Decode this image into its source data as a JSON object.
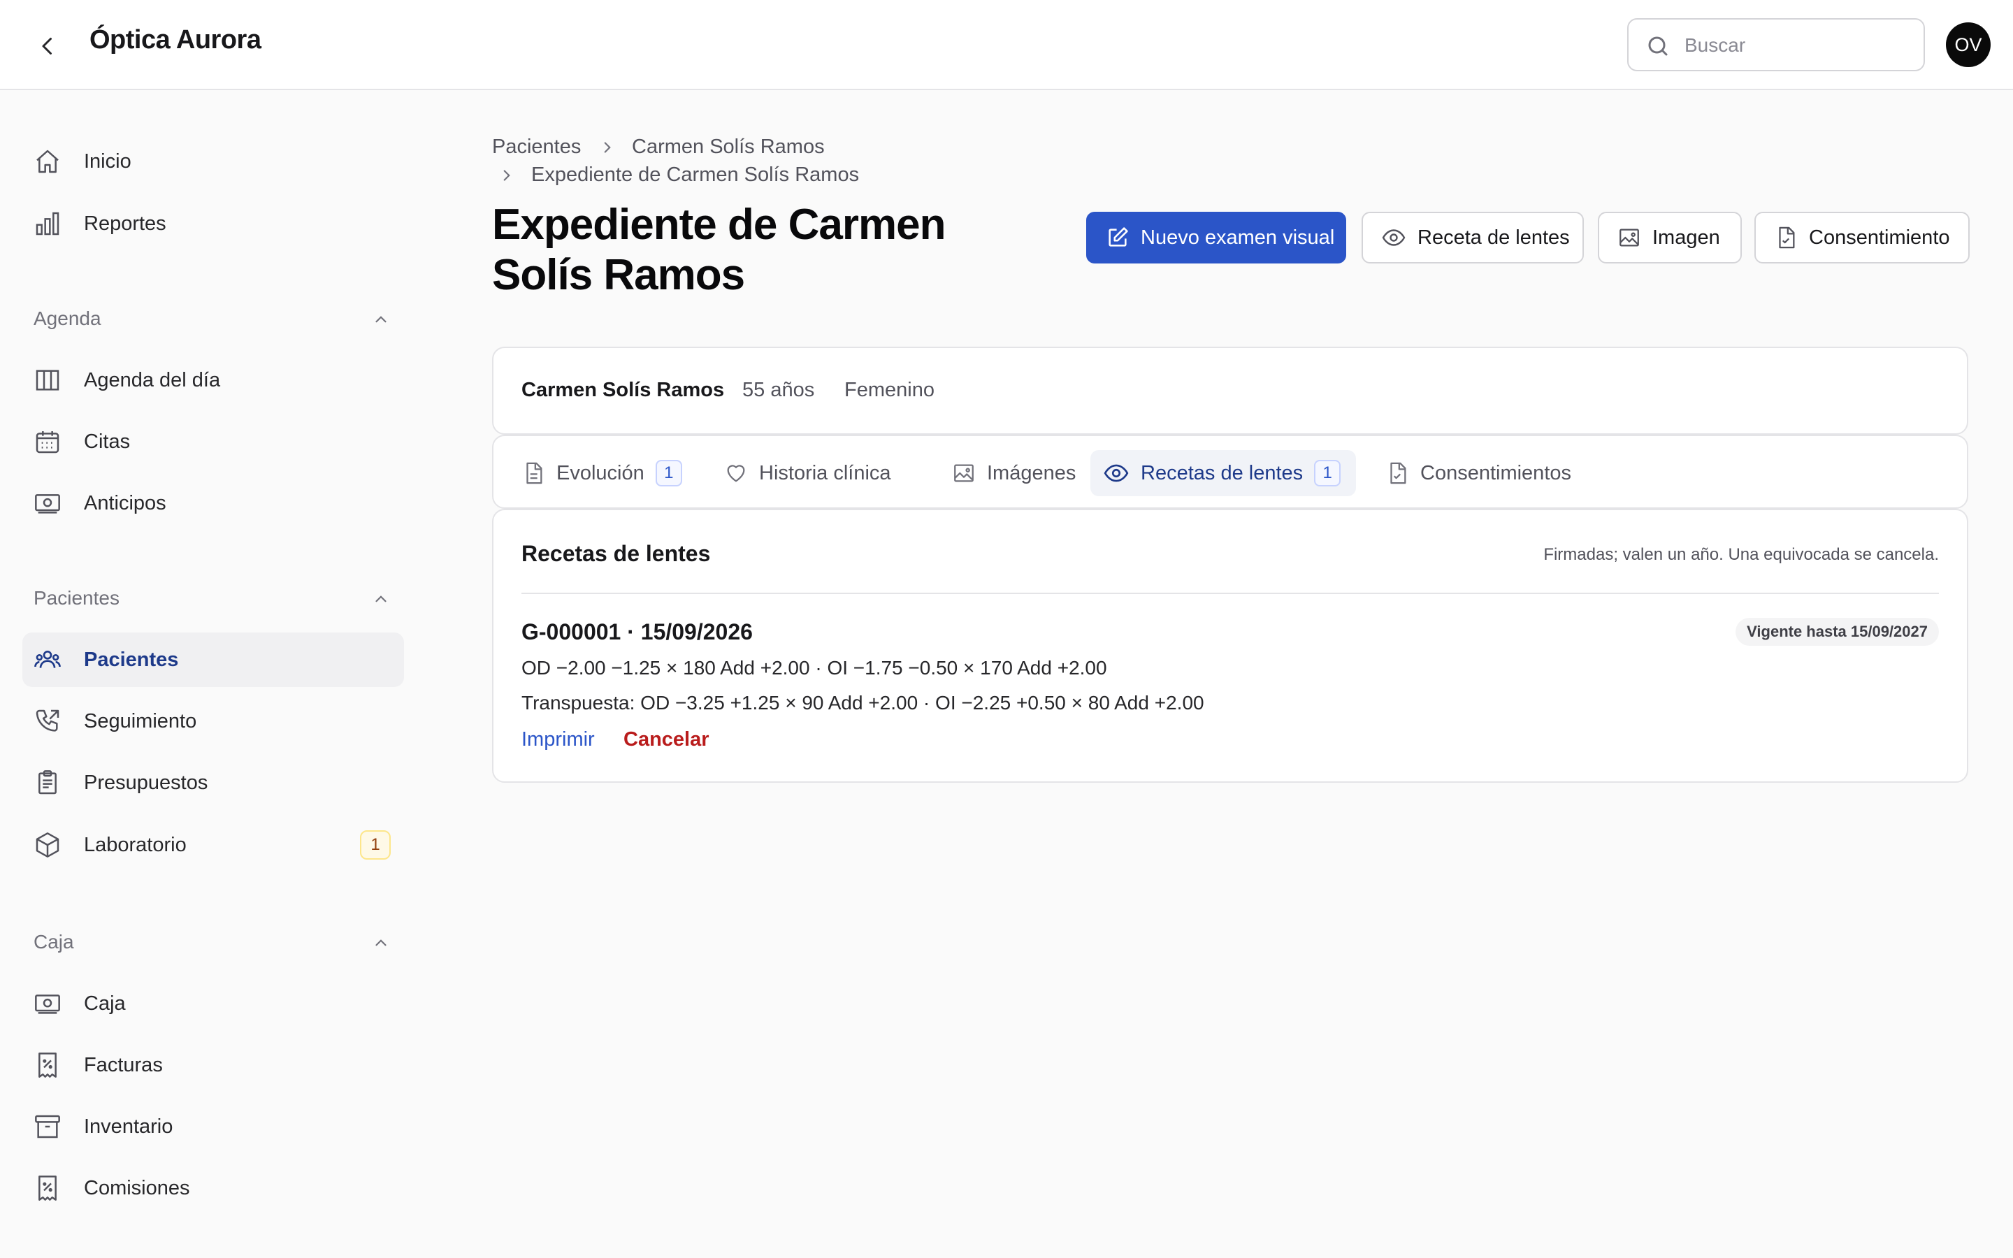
{
  "header": {
    "title": "Óptica Aurora",
    "search_placeholder": "Buscar",
    "avatar_initials": "OV"
  },
  "sidebar": {
    "top_items": [
      {
        "label": "Inicio",
        "icon": "home-icon"
      },
      {
        "label": "Reportes",
        "icon": "bar-chart-icon"
      }
    ],
    "sections": [
      {
        "title": "Agenda",
        "items": [
          {
            "label": "Agenda del día",
            "icon": "columns-icon"
          },
          {
            "label": "Citas",
            "icon": "calendar-icon"
          },
          {
            "label": "Anticipos",
            "icon": "money-icon"
          }
        ]
      },
      {
        "title": "Pacientes",
        "items": [
          {
            "label": "Pacientes",
            "icon": "users-icon",
            "active": true
          },
          {
            "label": "Seguimiento",
            "icon": "phone-outgoing-icon"
          },
          {
            "label": "Presupuestos",
            "icon": "clipboard-icon"
          },
          {
            "label": "Laboratorio",
            "icon": "box-icon",
            "badge": "1"
          }
        ]
      },
      {
        "title": "Caja",
        "items": [
          {
            "label": "Caja",
            "icon": "money-icon"
          },
          {
            "label": "Facturas",
            "icon": "receipt-percent-icon"
          },
          {
            "label": "Inventario",
            "icon": "archive-icon"
          },
          {
            "label": "Comisiones",
            "icon": "receipt-percent-icon"
          }
        ]
      }
    ]
  },
  "breadcrumb": {
    "items": [
      "Pacientes",
      "Carmen Solís Ramos"
    ],
    "current": "Expediente de Carmen Solís Ramos"
  },
  "page": {
    "title": "Expediente de Carmen Solís Ramos"
  },
  "actions": {
    "new_exam": "Nuevo examen visual",
    "prescription": "Receta de lentes",
    "image": "Imagen",
    "consent": "Consentimiento"
  },
  "patient": {
    "name": "Carmen Solís Ramos",
    "age": "55 años",
    "sex": "Femenino"
  },
  "tabs": [
    {
      "label": "Evolución",
      "count": "1",
      "icon": "document-icon"
    },
    {
      "label": "Historia clínica",
      "icon": "heart-icon"
    },
    {
      "label": "Imágenes",
      "icon": "image-icon"
    },
    {
      "label": "Recetas de lentes",
      "count": "1",
      "icon": "eye-icon",
      "active": true
    },
    {
      "label": "Consentimientos",
      "icon": "document-check-icon"
    }
  ],
  "prescriptions": {
    "title": "Recetas de lentes",
    "note": "Firmadas; valen un año. Una equivocada se cancela.",
    "items": [
      {
        "code": "G-000001 · 15/09/2026",
        "status": "Vigente hasta 15/09/2027",
        "line1": "OD −2.00 −1.25 × 180 Add +2.00 · OI −1.75 −0.50 × 170 Add +2.00",
        "line2": "Transpuesta: OD −3.25 +1.25 × 90 Add +2.00 · OI −2.25 +0.50 × 80 Add +2.00",
        "print_label": "Imprimir",
        "cancel_label": "Cancelar"
      }
    ]
  },
  "colors": {
    "primary": "#2b55c8",
    "active_text": "#1e3a8a",
    "danger": "#b91c1c",
    "background": "#fafafa"
  }
}
